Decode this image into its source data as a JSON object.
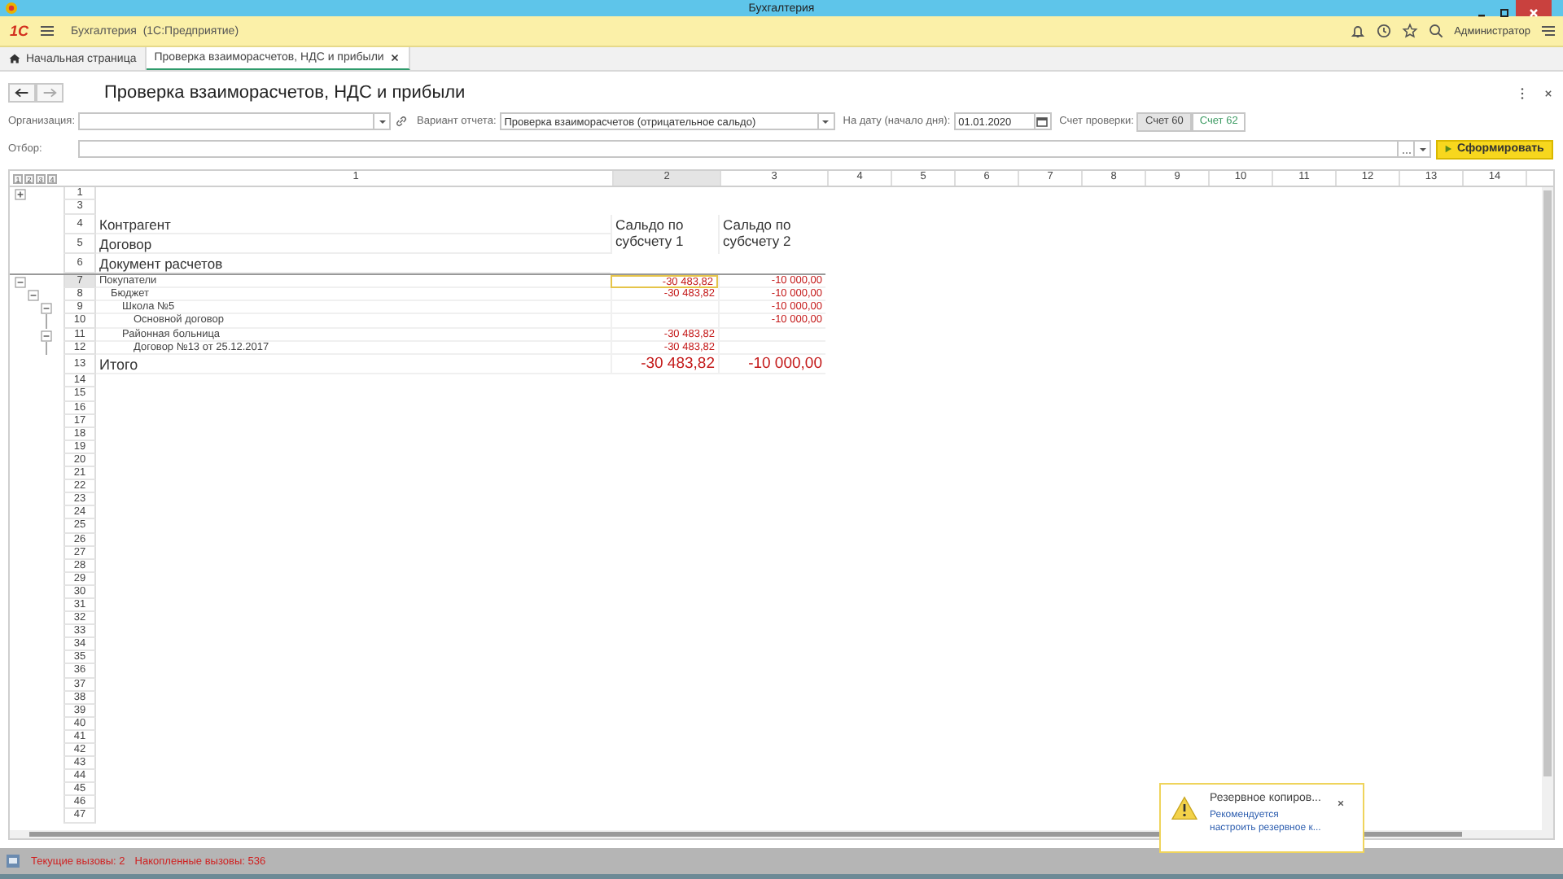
{
  "window": {
    "title": "Бухгалтерия"
  },
  "app_bar": {
    "logo": "1С",
    "title": "Бухгалтерия  (1С:Предприятие)",
    "user": "Администратор"
  },
  "tabs": [
    {
      "label": "Начальная страница",
      "kind": "home",
      "selected": false
    },
    {
      "label": "Проверка взаиморасчетов, НДС и прибыли",
      "kind": "document",
      "selected": true
    }
  ],
  "form": {
    "title": "Проверка взаиморасчетов, НДС и прибыли",
    "organization": {
      "label": "Организация:"
    },
    "variant": {
      "label": "Вариант отчета:",
      "value": "Проверка взаиморасчетов (отрицательное сальдо)"
    },
    "date": {
      "label": "На дату (начало дня):",
      "value": "01.01.2020"
    },
    "account": {
      "label": "Счет проверки:",
      "options": [
        {
          "label": "Счет 60",
          "selected": true
        },
        {
          "label": "Счет 62",
          "selected": false
        }
      ]
    },
    "filter": {
      "label": "Отбор:"
    },
    "generate_button": "Сформировать"
  },
  "sheet": {
    "outline_levels": [
      "1",
      "2",
      "3",
      "4"
    ],
    "columns": [
      {
        "label": "1",
        "selected": false
      },
      {
        "label": "2",
        "selected": true
      },
      {
        "label": "3",
        "selected": false
      },
      {
        "label": "4",
        "selected": false
      },
      {
        "label": "5",
        "selected": false
      },
      {
        "label": "6",
        "selected": false
      },
      {
        "label": "7",
        "selected": false
      },
      {
        "label": "8",
        "selected": false
      },
      {
        "label": "9",
        "selected": false
      },
      {
        "label": "10",
        "selected": false
      },
      {
        "label": "11",
        "selected": false
      },
      {
        "label": "12",
        "selected": false
      },
      {
        "label": "13",
        "selected": false
      },
      {
        "label": "14",
        "selected": false
      }
    ],
    "top_rows": [
      "1",
      "3"
    ],
    "header": {
      "rows": [
        {
          "number": "4",
          "label": "Контрагент"
        },
        {
          "number": "5",
          "label": "Договор"
        },
        {
          "number": "6",
          "label": "Документ расчетов"
        }
      ],
      "column_2": "Сальдо по субсчету 1",
      "column_3": "Сальдо по субсчету 2"
    },
    "tree": [
      {
        "number": "7",
        "name": "Покупатели",
        "column_2": "-30 483,82",
        "column_3": "-10 000,00",
        "selected": true,
        "expanded": true,
        "children": [
          {
            "number": "8",
            "name": "Бюджет",
            "column_2": "-30 483,82",
            "column_3": "-10 000,00",
            "selected": false,
            "expanded": true,
            "children": [
              {
                "number": "9",
                "name": "Школа №5",
                "column_3": "-10 000,00",
                "selected": false,
                "expanded": true,
                "children": [
                  {
                    "number": "10",
                    "name": "Основной договор",
                    "column_3": "-10 000,00",
                    "selected": false
                  }
                ]
              },
              {
                "number": "11",
                "name": "Районная больница",
                "column_2": "-30 483,82",
                "selected": false,
                "expanded": true,
                "children": [
                  {
                    "number": "12",
                    "name": "Договор №13 от 25.12.2017",
                    "column_2": "-30 483,82",
                    "selected": false
                  }
                ]
              }
            ]
          }
        ]
      }
    ],
    "total": {
      "number": "13",
      "label": "Итого",
      "column_2": "-30 483,82",
      "column_3": "-10 000,00"
    },
    "empty_rows": [
      "14",
      "15",
      "16",
      "17",
      "18",
      "19",
      "20",
      "21",
      "22",
      "23",
      "24",
      "25",
      "26",
      "27",
      "28",
      "29",
      "30",
      "31",
      "32",
      "33",
      "34",
      "35",
      "36",
      "37",
      "38",
      "39",
      "40",
      "41",
      "42",
      "43",
      "44",
      "45",
      "46",
      "47"
    ]
  },
  "status_bar": {
    "current_label": "Текущие вызовы:",
    "current": "2",
    "accumulated_label": "Накопленные вызовы:",
    "accumulated": "536"
  },
  "notification": {
    "title": "Резервное копиров...",
    "text": "Рекомендуется настроить резервное к..."
  }
}
